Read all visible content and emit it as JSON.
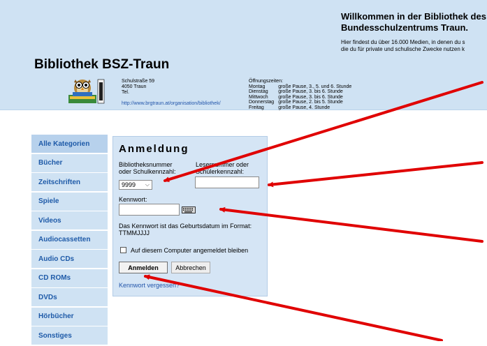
{
  "header": {
    "welcome_line1": "Willkommen in der Bibliothek des",
    "welcome_line2": "Bundesschulzentrums Traun.",
    "intro_line1": "Hier findest du über 16.000 Medien, in denen du s",
    "intro_line2": "die du für private und schulische Zwecke nutzen k",
    "site_title": "Bibliothek BSZ-Traun",
    "address": {
      "street": "Schulstraße 59",
      "city": "4050 Traun",
      "tel": "Tel.",
      "url": "http://www.brgtraun.at/organisation/bibliothek/"
    },
    "hours": {
      "heading": "Öffnungszeiten:",
      "rows": [
        {
          "day": "Montag",
          "time": "große Pause, 3., 5. und 6. Stunde"
        },
        {
          "day": "Dienstag",
          "time": "große Pause, 3. bis 6. Stunde"
        },
        {
          "day": "Mittwoch",
          "time": "große Pause, 3. bis 6. Stunde"
        },
        {
          "day": "Donnerstag",
          "time": "große Pause, 2. bis 5. Stunde"
        },
        {
          "day": "Freitag",
          "time": "große Pause, 4. Stunde"
        }
      ]
    }
  },
  "sidebar": {
    "items": [
      {
        "label": "Alle Kategorien"
      },
      {
        "label": "Bücher"
      },
      {
        "label": "Zeitschriften"
      },
      {
        "label": "Spiele"
      },
      {
        "label": "Videos"
      },
      {
        "label": "Audiocassetten"
      },
      {
        "label": "Audio CDs"
      },
      {
        "label": "CD ROMs"
      },
      {
        "label": "DVDs"
      },
      {
        "label": "Hörbücher"
      },
      {
        "label": "Sonstiges"
      }
    ]
  },
  "login": {
    "title": "Anmeldung",
    "library_label_line1": "Bibliotheksnummer",
    "library_label_line2": "oder Schulkennzahl:",
    "library_selected": "9999",
    "reader_label_line1": "Lesernummer oder",
    "reader_label_line2": "Schülerkennzahl:",
    "reader_value": "",
    "password_label": "Kennwort:",
    "password_value": "",
    "hint_line1": "Das Kennwort ist das Geburtsdatum im Format:",
    "hint_line2": "TTMMJJJJ",
    "remember_label": "Auf diesem Computer angemeldet bleiben",
    "remember_checked": false,
    "submit_label": "Anmelden",
    "cancel_label": "Abbrechen",
    "forgot_label": "Kennwort vergessen?"
  },
  "colors": {
    "header_bg": "#cfe2f3",
    "sidebar_bg": "#cfe2f3",
    "sidebar_text": "#1e5aa8",
    "login_bg": "#d5e5f5",
    "link": "#2255aa",
    "annotation_arrow": "#e00000"
  },
  "icons": {
    "logo": "owl-reading-book-logo",
    "keyboard": "keyboard-icon",
    "dropdown": "chevron-down-icon"
  }
}
